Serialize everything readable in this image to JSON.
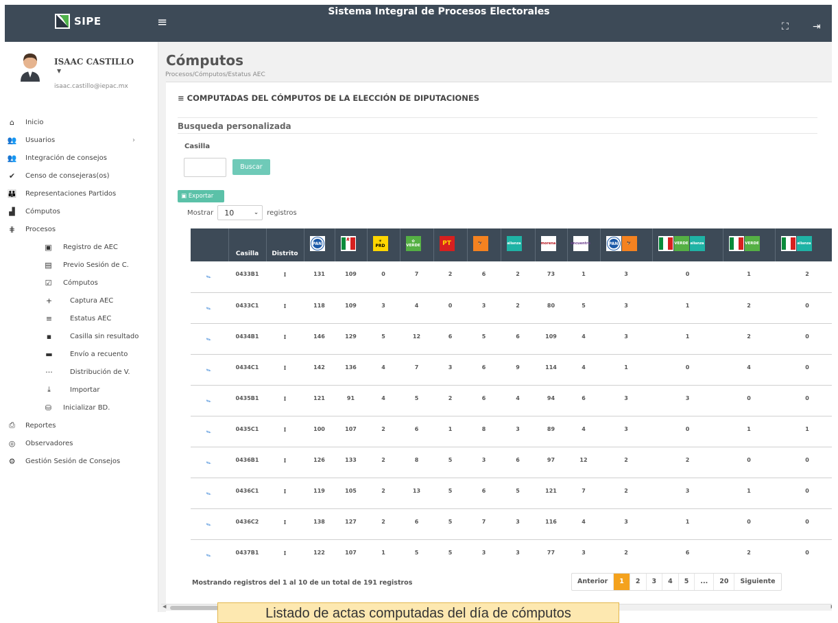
{
  "app": {
    "brand": "SIPE",
    "title": "Sistema Integral de Procesos Electorales"
  },
  "user": {
    "name": "ISAAC CASTILLO",
    "email": "isaac.castillo@iepac.mx"
  },
  "sidebar": {
    "items": [
      {
        "label": "Inicio",
        "icon": "home-icon",
        "glyph": "⌂",
        "level": 0
      },
      {
        "label": "Usuarios",
        "icon": "users-icon",
        "glyph": "👥",
        "level": 0,
        "chevron": "›"
      },
      {
        "label": "Integración de consejos",
        "icon": "group-icon",
        "glyph": "👥",
        "level": 0
      },
      {
        "label": "Censo de consejeras(os)",
        "icon": "check-icon",
        "glyph": "✔",
        "level": 0
      },
      {
        "label": "Representaciones Partidos",
        "icon": "people-icon",
        "glyph": "👪",
        "level": 0
      },
      {
        "label": "Cómputos",
        "icon": "chart-icon",
        "glyph": "▟",
        "level": 0
      },
      {
        "label": "Procesos",
        "icon": "process-icon",
        "glyph": "⋕",
        "level": 0
      },
      {
        "label": "Registro de AEC",
        "icon": "file-icon",
        "glyph": "▣",
        "level": 1
      },
      {
        "label": "Previo Sesión de C.",
        "icon": "list-box-icon",
        "glyph": "▤",
        "level": 1
      },
      {
        "label": "Cómputos",
        "icon": "check-box-icon",
        "glyph": "☑",
        "level": 1
      },
      {
        "label": "Captura AEC",
        "icon": "plus-icon",
        "glyph": "+",
        "level": 2
      },
      {
        "label": "Estatus AEC",
        "icon": "list-icon",
        "glyph": "≡",
        "level": 2
      },
      {
        "label": "Casilla sin resultado",
        "icon": "alert-message-icon",
        "glyph": "▪",
        "level": 2
      },
      {
        "label": "Envío a recuento",
        "icon": "message-icon",
        "glyph": "▬",
        "level": 2
      },
      {
        "label": "Distribución de V.",
        "icon": "dots-icon",
        "glyph": "···",
        "level": 2
      },
      {
        "label": "Importar",
        "icon": "import-icon",
        "glyph": "⤓",
        "level": 2
      },
      {
        "label": "Inicializar BD.",
        "icon": "database-icon",
        "glyph": "⛁",
        "level": 1
      },
      {
        "label": "Reportes",
        "icon": "printer-icon",
        "glyph": "⎙",
        "level": 0
      },
      {
        "label": "Observadores",
        "icon": "eye-icon",
        "glyph": "◎",
        "level": 0
      },
      {
        "label": "Gestión Sesión de Consejos",
        "icon": "gear-icon",
        "glyph": "⚙",
        "level": 0
      }
    ]
  },
  "page": {
    "title": "Cómputos",
    "breadcrumb": "Procesos/Cómputos/Estatus AEC",
    "card_title": "COMPUTADAS DEL CÓMPUTOS DE LA ELECCIÓN DE DIPUTACIONES",
    "search_section": "Busqueda personalizada",
    "casilla_label": "Casilla",
    "casilla_value": "",
    "search_button": "Buscar",
    "export_button": "Exportar",
    "show_prefix": "Mostrar",
    "show_value": "10",
    "show_suffix": "registros"
  },
  "table": {
    "headers": [
      "",
      "Casilla",
      "Distrito",
      "PAN",
      "PRI",
      "PRD",
      "VERDE",
      "PT",
      "MC",
      "Nueva Alianza",
      "morena",
      "encuentro",
      "PAN-MC",
      "PRI-VERDE-Nueva Alianza",
      "PRI-VERDE",
      "PRI-Nueva Alianza"
    ],
    "rows": [
      [
        "0433B1",
        "I",
        "131",
        "109",
        "0",
        "7",
        "2",
        "6",
        "2",
        "73",
        "1",
        "3",
        "0",
        "1",
        "2"
      ],
      [
        "0433C1",
        "I",
        "118",
        "109",
        "3",
        "4",
        "0",
        "3",
        "2",
        "80",
        "5",
        "3",
        "1",
        "2",
        "0"
      ],
      [
        "0434B1",
        "I",
        "146",
        "129",
        "5",
        "12",
        "6",
        "5",
        "6",
        "109",
        "4",
        "3",
        "1",
        "2",
        "0"
      ],
      [
        "0434C1",
        "I",
        "142",
        "136",
        "4",
        "7",
        "3",
        "6",
        "9",
        "114",
        "4",
        "1",
        "0",
        "4",
        "0"
      ],
      [
        "0435B1",
        "I",
        "121",
        "91",
        "4",
        "5",
        "2",
        "6",
        "4",
        "94",
        "6",
        "3",
        "3",
        "0",
        "0"
      ],
      [
        "0435C1",
        "I",
        "100",
        "107",
        "2",
        "6",
        "1",
        "8",
        "3",
        "89",
        "4",
        "3",
        "0",
        "1",
        "1"
      ],
      [
        "0436B1",
        "I",
        "126",
        "133",
        "2",
        "8",
        "5",
        "3",
        "6",
        "97",
        "12",
        "2",
        "2",
        "0",
        "0"
      ],
      [
        "0436C1",
        "I",
        "119",
        "105",
        "2",
        "13",
        "5",
        "6",
        "5",
        "121",
        "7",
        "2",
        "3",
        "1",
        "0"
      ],
      [
        "0436C2",
        "I",
        "138",
        "127",
        "2",
        "6",
        "5",
        "7",
        "3",
        "116",
        "4",
        "3",
        "1",
        "0",
        "0"
      ],
      [
        "0437B1",
        "I",
        "122",
        "107",
        "1",
        "5",
        "5",
        "3",
        "3",
        "77",
        "3",
        "2",
        "6",
        "2",
        "0"
      ]
    ]
  },
  "footer": {
    "info": "Mostrando registros del 1 al 10 de un total de 191 registros",
    "pages": [
      "Anterior",
      "1",
      "2",
      "3",
      "4",
      "5",
      "...",
      "20",
      "Siguiente"
    ],
    "active_page": "1"
  },
  "caption": "Listado de actas computadas del día de cómputos",
  "colors": {
    "topbar": "#3d4a57",
    "accent_green": "#6fcab8",
    "pager_active": "#f4a21d",
    "edit_blue": "#2a7bd4"
  }
}
